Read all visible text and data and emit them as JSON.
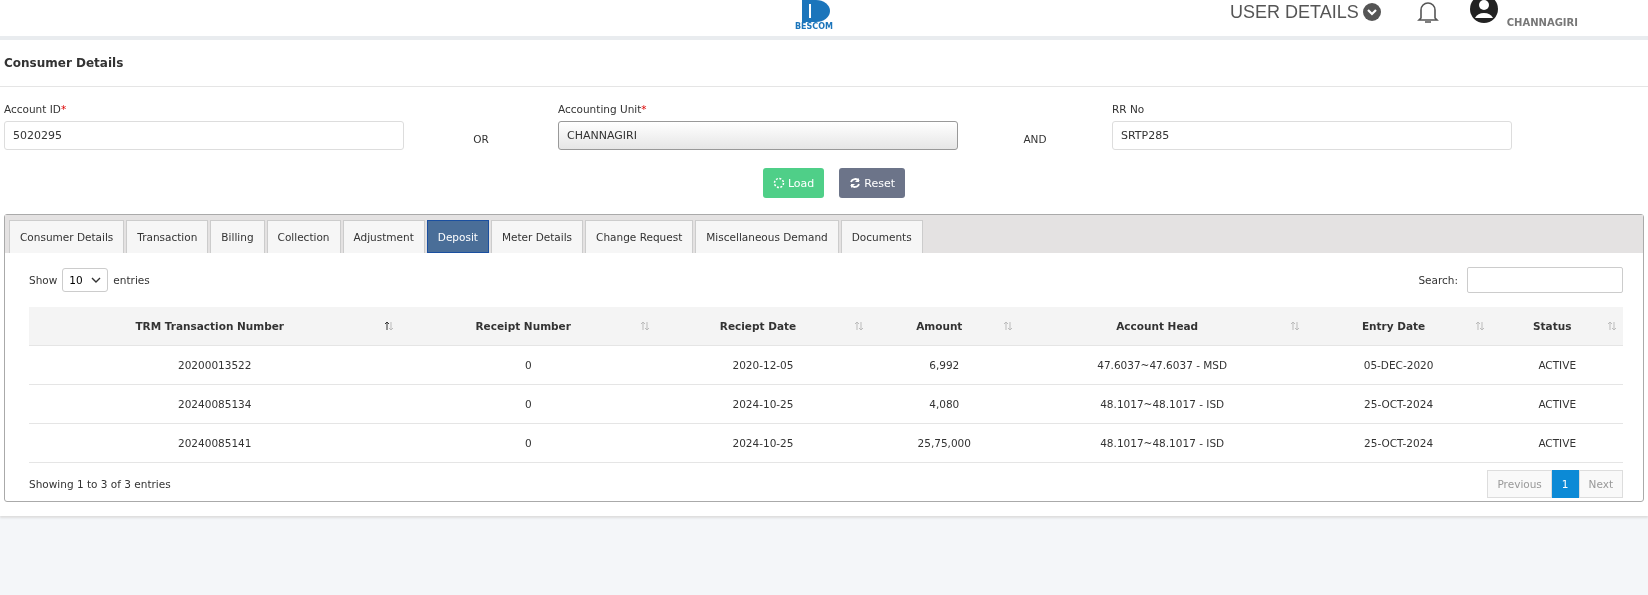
{
  "header": {
    "logo_text": "BESCOM",
    "user_details": "USER DETAILS",
    "user_location": "CHANNAGIRI"
  },
  "section_title": "Consumer Details",
  "form": {
    "fields": [
      {
        "label": "Account ID",
        "required_mark": "*",
        "value": "5020295",
        "disabled": false
      },
      {
        "label": "Accounting Unit",
        "required_mark": "*",
        "value": "CHANNAGIRI",
        "disabled": true
      },
      {
        "label": "RR No",
        "value": "SRTP285",
        "disabled": false
      }
    ],
    "connectors": [
      "OR",
      "AND"
    ],
    "buttons": [
      {
        "label": "Load",
        "kind": "load"
      },
      {
        "label": "Reset",
        "kind": "reset"
      }
    ]
  },
  "tabs": [
    {
      "label": "Consumer Details",
      "selected": false
    },
    {
      "label": "Transaction",
      "selected": false
    },
    {
      "label": "Billing",
      "selected": false
    },
    {
      "label": "Collection",
      "selected": false
    },
    {
      "label": "Adjustment",
      "selected": false
    },
    {
      "label": "Deposit",
      "selected": true
    },
    {
      "label": "Meter Details",
      "selected": false
    },
    {
      "label": "Change Request",
      "selected": false
    },
    {
      "label": "Miscellaneous Demand",
      "selected": false
    },
    {
      "label": "Documents",
      "selected": false
    }
  ],
  "table": {
    "show_label": "Show",
    "page_size": "10",
    "entries_label": "entries",
    "search_label": "Search:",
    "columns": [
      {
        "label": "TRM Transaction Number",
        "sorted": true
      },
      {
        "label": "Receipt Number",
        "sorted": false
      },
      {
        "label": "Reciept Date",
        "sorted": false
      },
      {
        "label": "Amount",
        "sorted": false
      },
      {
        "label": "Account Head",
        "sorted": false
      },
      {
        "label": "Entry Date",
        "sorted": false
      },
      {
        "label": "Status",
        "sorted": false
      }
    ],
    "rows": [
      [
        "20200013522",
        "0",
        "2020-12-05",
        "6,992",
        "47.6037~47.6037 - MSD",
        "05-DEC-2020",
        "ACTIVE"
      ],
      [
        "20240085134",
        "0",
        "2024-10-25",
        "4,080",
        "48.1017~48.1017 - ISD",
        "25-OCT-2024",
        "ACTIVE"
      ],
      [
        "20240085141",
        "0",
        "2024-10-25",
        "25,75,000",
        "48.1017~48.1017 - ISD",
        "25-OCT-2024",
        "ACTIVE"
      ]
    ],
    "info": "Showing 1 to 3 of 3 entries",
    "pagination": [
      {
        "label": "Previous",
        "selected": false,
        "disabled": true
      },
      {
        "label": "1",
        "selected": true,
        "disabled": false
      },
      {
        "label": "Next",
        "selected": false,
        "disabled": true
      }
    ]
  }
}
